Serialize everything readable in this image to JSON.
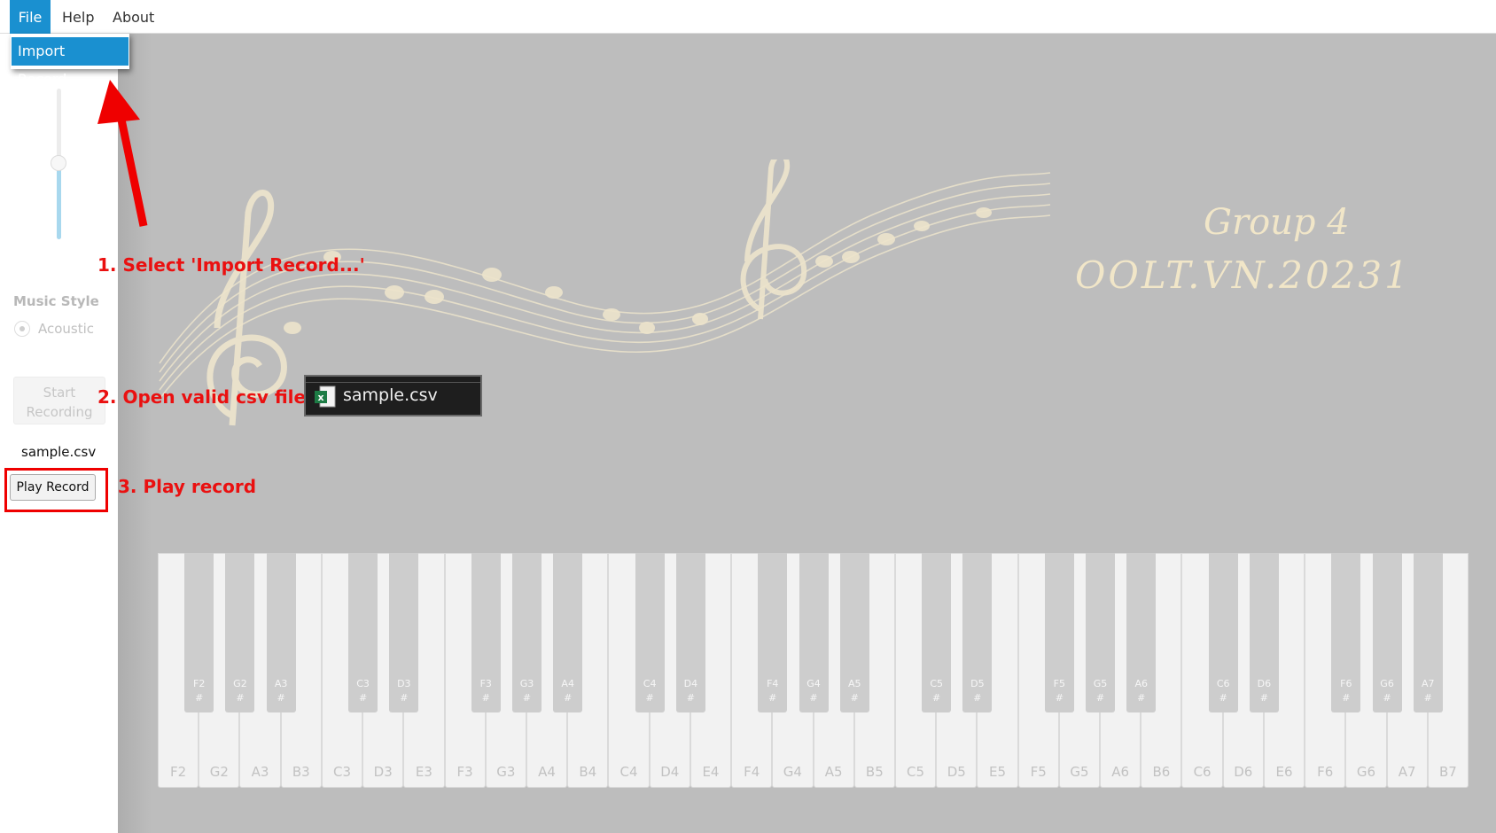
{
  "menu": {
    "items": [
      {
        "label": "File",
        "active": true
      },
      {
        "label": "Help",
        "active": false
      },
      {
        "label": "About",
        "active": false
      }
    ],
    "dropdown": {
      "item": "Import Record..."
    }
  },
  "sidebar": {
    "volume_level": 0.5,
    "music_style_label": "Music Style",
    "style_option": "Acoustic",
    "start_button": [
      "Start",
      "Recording"
    ],
    "file_name": "sample.csv",
    "play_button": "Play Record"
  },
  "annotations": {
    "step1": "1. Select 'Import Record...'",
    "step2": "2. Open valid csv file",
    "step3": "3. Play record",
    "color": "#ea1010"
  },
  "title": {
    "line1": "Group 4",
    "line2": "OOLT.VN.20231"
  },
  "csv_tile": {
    "name": "sample.csv",
    "icon": "excel-csv-icon"
  },
  "piano": {
    "white_keys": [
      "F2",
      "G2",
      "A3",
      "B3",
      "C3",
      "D3",
      "E3",
      "F3",
      "G3",
      "A4",
      "B4",
      "C4",
      "D4",
      "E4",
      "F4",
      "G4",
      "A5",
      "B5",
      "C5",
      "D5",
      "E5",
      "F5",
      "G5",
      "A6",
      "B6",
      "C6",
      "D6",
      "E6",
      "F6",
      "G6",
      "A7",
      "B7"
    ],
    "black_keys": [
      "F2",
      "G2",
      "A3",
      "C3",
      "D3",
      "F3",
      "G3",
      "A4",
      "C4",
      "D4",
      "F4",
      "G4",
      "A5",
      "C5",
      "D5",
      "F5",
      "G5",
      "A6",
      "C6",
      "D6",
      "F6",
      "G6",
      "A7"
    ],
    "sharp_symbol": "#"
  },
  "colors": {
    "accent": "#1a90d0",
    "background": "#bdbdbd",
    "title": "#f1e6c8"
  }
}
